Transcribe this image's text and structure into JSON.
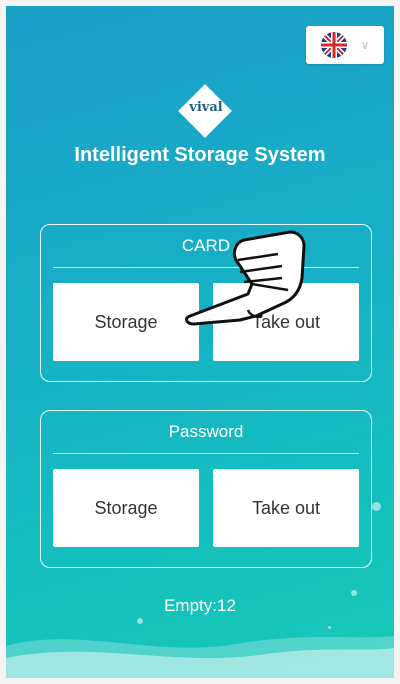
{
  "language_selector": {
    "flag_icon": "uk-flag-icon",
    "chevron_icon": "chevron-down-icon"
  },
  "logo": {
    "text": "vival"
  },
  "app_title": "Intelligent Storage System",
  "card_panel": {
    "title": "CARD",
    "storage_label": "Storage",
    "takeout_label": "Take out"
  },
  "password_panel": {
    "title": "Password",
    "storage_label": "Storage",
    "takeout_label": "Take out"
  },
  "status": {
    "empty_text": "Empty:12"
  },
  "overlay": {
    "icon": "pointing-hand-icon"
  },
  "colors": {
    "gradient_top": "#1a9fc9",
    "gradient_bottom": "#19c8b8",
    "button_bg": "#ffffff",
    "logo_text": "#1d5e8f"
  }
}
